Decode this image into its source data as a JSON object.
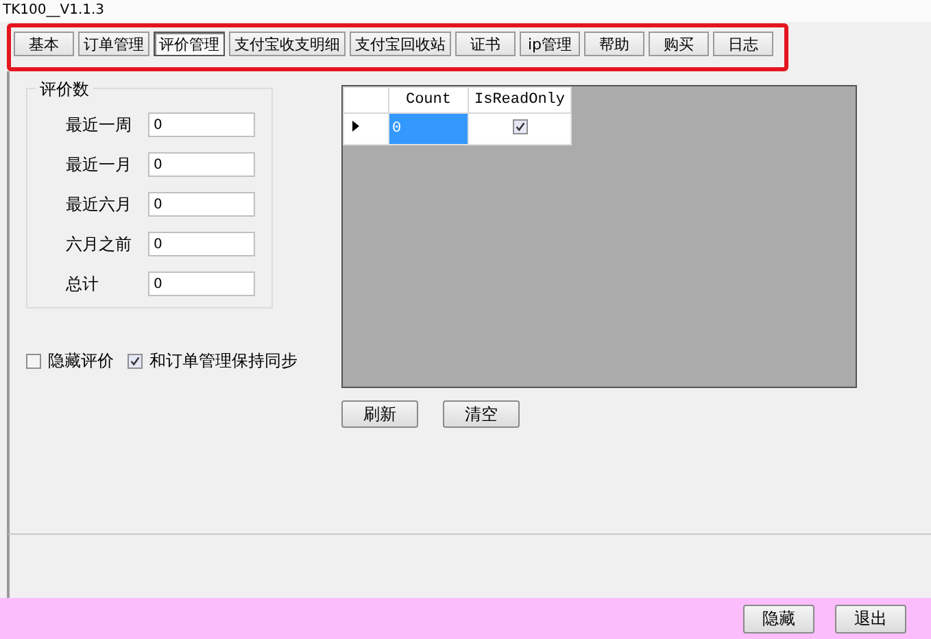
{
  "window": {
    "title": "TK100__V1.1.3"
  },
  "tabs": [
    {
      "label": "基本",
      "selected": false
    },
    {
      "label": "订单管理",
      "selected": false
    },
    {
      "label": "评价管理",
      "selected": true
    },
    {
      "label": "支付宝收支明细",
      "selected": false
    },
    {
      "label": "支付宝回收站",
      "selected": false
    },
    {
      "label": "证书",
      "selected": false
    },
    {
      "label": "ip管理",
      "selected": false
    },
    {
      "label": "帮助",
      "selected": false
    },
    {
      "label": "购买",
      "selected": false
    },
    {
      "label": "日志",
      "selected": false
    }
  ],
  "review_counts": {
    "title": "评价数",
    "fields": [
      {
        "label": "最近一周",
        "value": "0"
      },
      {
        "label": "最近一月",
        "value": "0"
      },
      {
        "label": "最近六月",
        "value": "0"
      },
      {
        "label": "六月之前",
        "value": "0"
      },
      {
        "label": "总计",
        "value": "0"
      }
    ]
  },
  "options": [
    {
      "label": "隐藏评价",
      "checked": false
    },
    {
      "label": "和订单管理保持同步",
      "checked": true
    }
  ],
  "grid": {
    "columns": [
      "Count",
      "IsReadOnly"
    ],
    "rows": [
      {
        "current": true,
        "count": "0",
        "count_selected": true,
        "is_read_only": true
      }
    ]
  },
  "grid_buttons": [
    "刷新",
    "清空"
  ],
  "footer_buttons": [
    "隐藏",
    "退出"
  ]
}
